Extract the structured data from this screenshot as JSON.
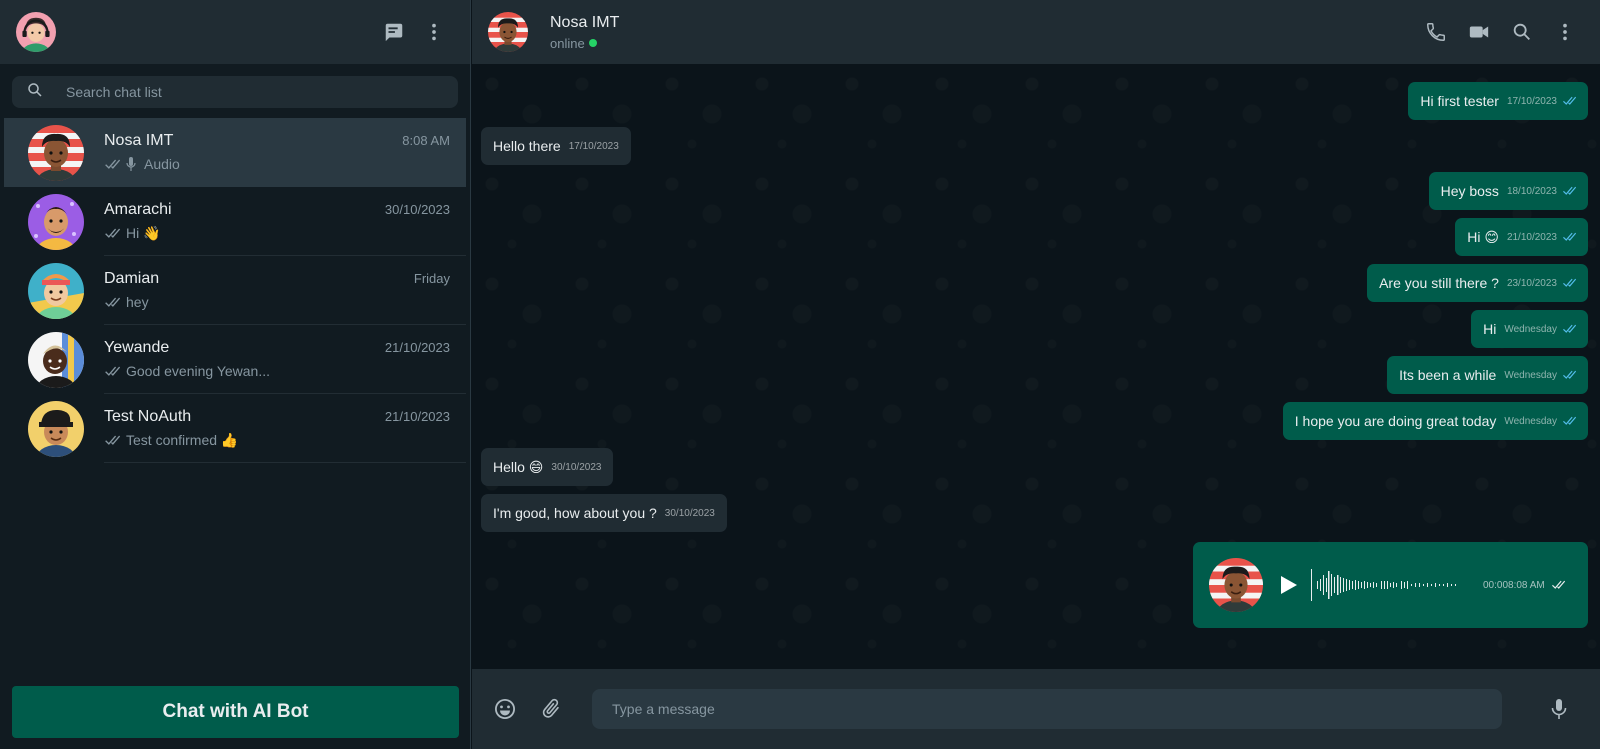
{
  "sidebar": {
    "search": {
      "placeholder": "Search chat list"
    },
    "chats": [
      {
        "name": "Nosa IMT",
        "time": "8:08 AM",
        "preview": "Audio"
      },
      {
        "name": "Amarachi",
        "time": "30/10/2023",
        "preview": "Hi 👋"
      },
      {
        "name": "Damian",
        "time": "Friday",
        "preview": "hey"
      },
      {
        "name": "Yewande",
        "time": "21/10/2023",
        "preview": "Good evening Yewan..."
      },
      {
        "name": "Test NoAuth",
        "time": "21/10/2023",
        "preview": "Test confirmed 👍"
      }
    ],
    "ai_button": "Chat with AI Bot"
  },
  "chat": {
    "contact": {
      "name": "Nosa IMT",
      "status": "online"
    },
    "messages": [
      {
        "text": "Hi first tester",
        "time": "17/10/2023"
      },
      {
        "text": "Hello there",
        "time": "17/10/2023"
      },
      {
        "text": "Hey boss",
        "time": "18/10/2023"
      },
      {
        "text": "Hi 😊",
        "time": "21/10/2023"
      },
      {
        "text": "Are you still there ?",
        "time": "23/10/2023"
      },
      {
        "text": "Hi",
        "time": "Wednesday"
      },
      {
        "text": "Its been a while",
        "time": "Wednesday"
      },
      {
        "text": "I hope you are doing great today",
        "time": "Wednesday"
      },
      {
        "text": "Hello 😄",
        "time": "30/10/2023"
      },
      {
        "text": "I'm good, how about you ?",
        "time": "30/10/2023"
      }
    ],
    "voice_note": {
      "time": "00:008:08 AM"
    },
    "composer": {
      "placeholder": "Type a message"
    }
  },
  "colors": {
    "accent": "#005c4b",
    "incoming_bubble": "#202c33",
    "background": "#0b141a",
    "panel": "#111b21",
    "read_tick": "#53bdeb",
    "online": "#25d366"
  },
  "icons": [
    "new-chat-icon",
    "menu-dots-icon",
    "search-icon",
    "double-check-icon",
    "mic-icon",
    "phone-icon",
    "video-icon",
    "emoji-icon",
    "attach-icon",
    "play-icon"
  ]
}
